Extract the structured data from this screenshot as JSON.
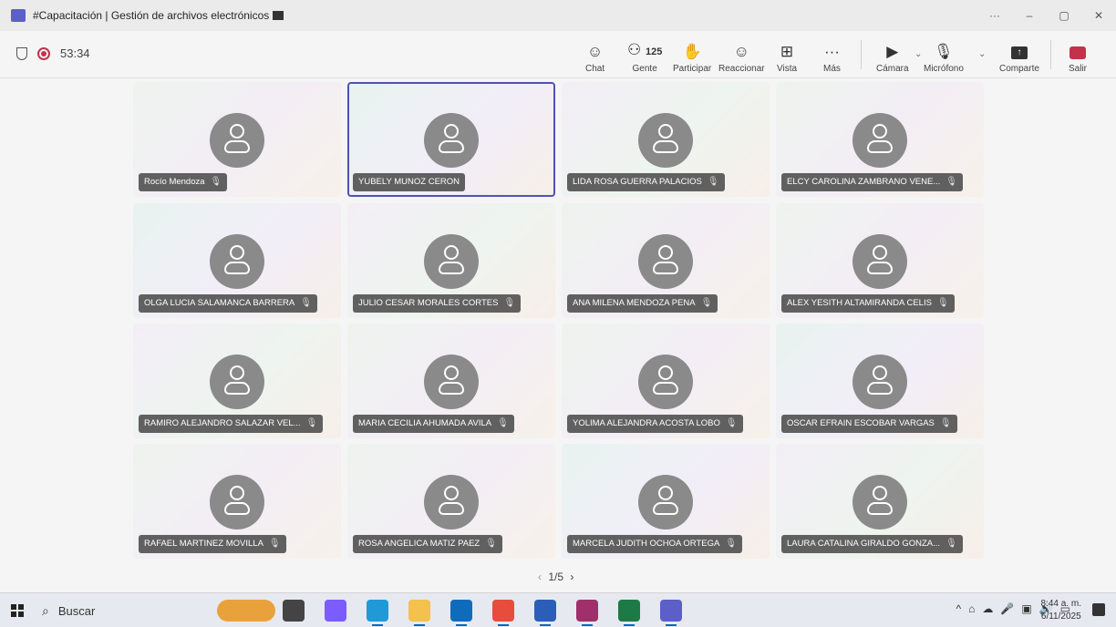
{
  "window": {
    "title": "#Capacitación | Gestión de archivos electrónicos",
    "controls": [
      "···",
      "–",
      "▢",
      "✕"
    ]
  },
  "meeting": {
    "timer": "53:34",
    "toolbar": [
      {
        "id": "chat",
        "icon": "chat-icon",
        "label": "Chat"
      },
      {
        "id": "people",
        "icon": "people-icon",
        "label": "Gente",
        "count": "125"
      },
      {
        "id": "raise",
        "icon": "raise-hand-icon",
        "label": "Participar"
      },
      {
        "id": "react",
        "icon": "react-icon",
        "label": "Reaccionar"
      },
      {
        "id": "view",
        "icon": "view-grid-icon",
        "label": "Vista"
      },
      {
        "id": "more",
        "icon": "more-icon",
        "label": "Más"
      },
      {
        "id": "camera",
        "icon": "camera-off-icon",
        "label": "Cámara"
      },
      {
        "id": "mic",
        "icon": "mic-off-icon",
        "label": "Micrófono"
      },
      {
        "id": "share",
        "icon": "share-icon",
        "label": "Comparte"
      },
      {
        "id": "leave",
        "icon": "leave-icon",
        "label": "Salir"
      }
    ]
  },
  "participants": [
    {
      "name": "Rocío Mendoza",
      "muted": true
    },
    {
      "name": "YUBELY MUNOZ CERON",
      "muted": false,
      "active": true
    },
    {
      "name": "LIDA ROSA GUERRA PALACIOS",
      "muted": true
    },
    {
      "name": "ELCY CAROLINA ZAMBRANO VENE...",
      "muted": true
    },
    {
      "name": "OLGA LUCIA SALAMANCA BARRERA",
      "muted": true
    },
    {
      "name": "JULIO CESAR MORALES CORTES",
      "muted": true
    },
    {
      "name": "ANA MILENA MENDOZA PENA",
      "muted": true
    },
    {
      "name": "ALEX YESITH ALTAMIRANDA CELIS",
      "muted": true
    },
    {
      "name": "RAMIRO ALEJANDRO SALAZAR VEL...",
      "muted": true
    },
    {
      "name": "MARIA CECILIA AHUMADA AVILA",
      "muted": true
    },
    {
      "name": "YOLIMA ALEJANDRA ACOSTA LOBO",
      "muted": true
    },
    {
      "name": "OSCAR EFRAIN ESCOBAR VARGAS",
      "muted": true
    },
    {
      "name": "RAFAEL MARTINEZ MOVILLA",
      "muted": true
    },
    {
      "name": "ROSA ANGELICA MATIZ PAEZ",
      "muted": true
    },
    {
      "name": "MARCELA JUDITH OCHOA ORTEGA",
      "muted": true
    },
    {
      "name": "LAURA CATALINA GIRALDO GONZA...",
      "muted": true
    }
  ],
  "pager": {
    "text": "1/5"
  },
  "taskbar": {
    "search_label": "Buscar",
    "time": "8:44 a. m.",
    "date": "6/11/2025",
    "tray_icons": [
      "^",
      "⌂",
      "☁",
      "🎤",
      "▣",
      "🔊",
      "▭"
    ],
    "apps": [
      {
        "name": "widgets-icon",
        "color": "#e9a23b"
      },
      {
        "name": "task-view-icon",
        "color": "#444444"
      },
      {
        "name": "copilot-icon",
        "color": "#7b5cff"
      },
      {
        "name": "edge-icon",
        "color": "#1f9ad6"
      },
      {
        "name": "file-explorer-icon",
        "color": "#f2c14e"
      },
      {
        "name": "outlook-icon",
        "color": "#0f6cbd"
      },
      {
        "name": "chrome-icon",
        "color": "#e84c3d"
      },
      {
        "name": "word-icon",
        "color": "#2b5eb8"
      },
      {
        "name": "winrar-icon",
        "color": "#a0306b"
      },
      {
        "name": "excel-icon",
        "color": "#1d7a45"
      },
      {
        "name": "teams-icon",
        "color": "#5b5fc7"
      }
    ]
  }
}
